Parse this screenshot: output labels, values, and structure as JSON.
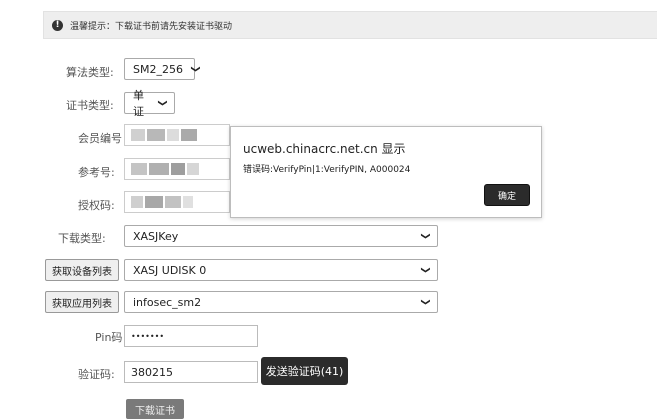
{
  "notice": {
    "text": "温馨提示：下载证书前请先安装证书驱动",
    "icon": "info-icon"
  },
  "form": {
    "algorithm": {
      "label": "算法类型:",
      "value": "SM2_256"
    },
    "cert_type": {
      "label": "证书类型:",
      "value": "单证"
    },
    "member_no": {
      "label": "会员编号"
    },
    "ref_no": {
      "label": "参考号:"
    },
    "auth_code": {
      "label": "授权码:"
    },
    "download_type": {
      "label": "下载类型:",
      "value": "XASJKey"
    },
    "device_list": {
      "button": "获取设备列表",
      "value": "XASJ UDISK 0"
    },
    "app_list": {
      "button": "获取应用列表",
      "value": "infosec_sm2"
    },
    "pin": {
      "label": "Pin码",
      "value": "•••••••"
    },
    "verify_code": {
      "label": "验证码:",
      "value": "380215",
      "send_button": "发送验证码(41)"
    },
    "download_button": "下载证书"
  },
  "dialog": {
    "title": "ucweb.chinacrc.net.cn 显示",
    "message": "错误码:VerifyPin|1:VerifyPIN, A000024",
    "ok": "确定"
  },
  "colors": {
    "dark_button": "#2b2b2b",
    "notice_bg": "#eeeeee"
  }
}
